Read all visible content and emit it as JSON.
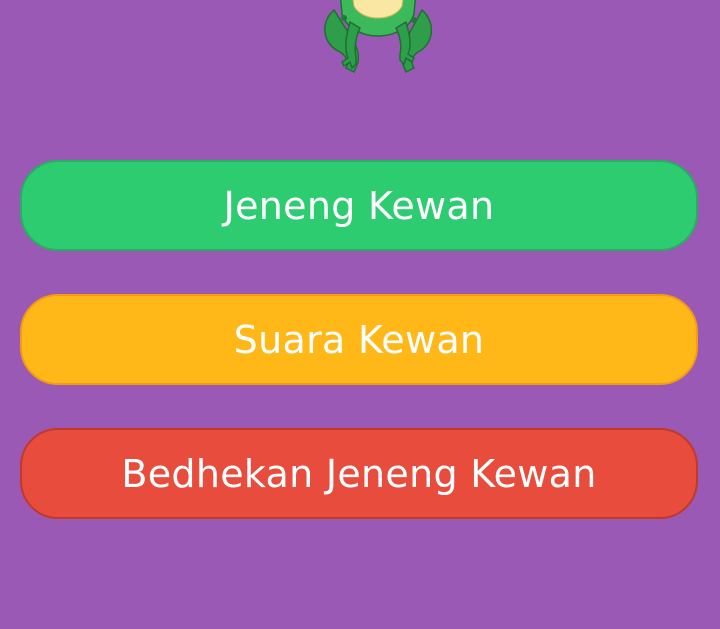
{
  "theme": {
    "background": "#9b59b6"
  },
  "mascot": {
    "icon": "frog-icon"
  },
  "menu": {
    "buttons": [
      {
        "label": "Jeneng Kewan",
        "color": "#2ecc71",
        "border": "#27ae60"
      },
      {
        "label": "Suara Kewan",
        "color": "#ffb818",
        "border": "#f39c12"
      },
      {
        "label": "Bedhekan Jeneng Kewan",
        "color": "#e74c3c",
        "border": "#c0392b"
      }
    ]
  }
}
